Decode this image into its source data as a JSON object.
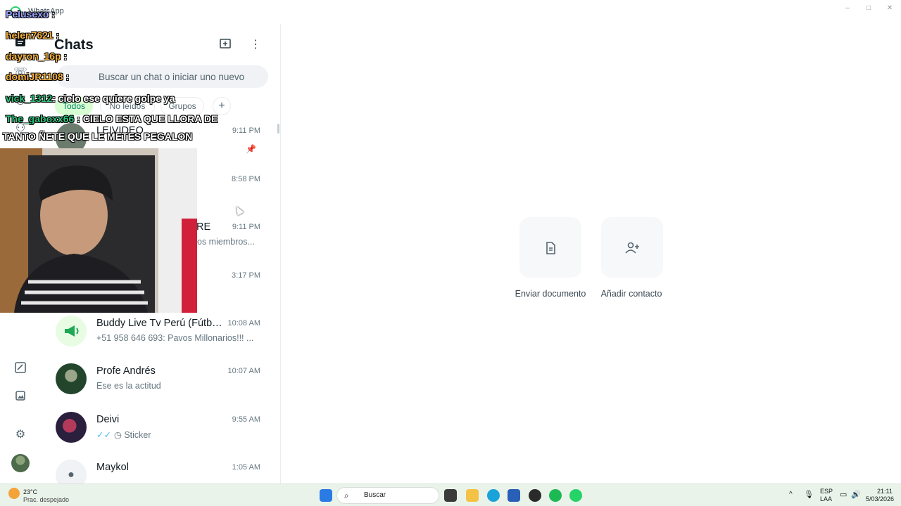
{
  "window": {
    "title": "WhatsApp",
    "controls": [
      "–",
      "□",
      "✕"
    ]
  },
  "rail": {
    "items": [
      "chats-icon",
      "calls-icon",
      "status-icon",
      "communities-icon",
      "starred-icon",
      "media-icon",
      "settings-icon"
    ]
  },
  "panel": {
    "title": "Chats",
    "search_placeholder": "Buscar un chat o iniciar uno nuevo",
    "filters": [
      {
        "label": "Todos",
        "active": true
      },
      {
        "label": "No leídos",
        "active": false
      },
      {
        "label": "Grupos",
        "active": false
      }
    ],
    "add_filter": "+"
  },
  "chats": [
    {
      "name": "LEIVIDEO",
      "time": "9:11 PM",
      "preview": "",
      "pinned": true
    },
    {
      "name": "",
      "time": "8:58 PM",
      "preview": ""
    },
    {
      "name": "RE",
      "time": "9:11 PM",
      "preview": "os miembros..."
    },
    {
      "name": "",
      "time": "3:17 PM",
      "preview": ""
    },
    {
      "name": "Buddy Live Tv Perú (Fútbol...",
      "time": "10:08 AM",
      "preview": "+51 958 646 693: Pavos Millonarios!!! ..."
    },
    {
      "name": "Profe Andrés",
      "time": "10:07 AM",
      "preview": "Ese es la actitud"
    },
    {
      "name": "Deivi",
      "time": "9:55 AM",
      "preview": "Sticker",
      "ticks": "✓✓"
    },
    {
      "name": "Maykol",
      "time": "1:05 AM",
      "preview": ""
    }
  ],
  "main": {
    "actions": [
      {
        "label": "Enviar documento",
        "icon": "document-icon"
      },
      {
        "label": "Añadir contacto",
        "icon": "add-contact-icon"
      }
    ]
  },
  "stream_overlay": {
    "lines": [
      {
        "user": "Pelusexo",
        "message": ":"
      },
      {
        "user": "helen7621",
        "message": ":"
      },
      {
        "user": "dayron_16p",
        "message": ":"
      },
      {
        "user": "domiJR1108",
        "message": ":"
      },
      {
        "user": "vick_1312",
        "message": ": cielo ese quiere golpe ya"
      },
      {
        "user": "The_gaboxx66",
        "message": ": CIELO ESTA QUE LLORA DE"
      },
      {
        "user": "",
        "message": "TANTO ÑETE QUE LE METES PEGALON"
      }
    ]
  },
  "taskbar": {
    "weather_temp": "23°C",
    "weather_desc": "Prac. despejado",
    "search_label": "Buscar",
    "lang_top": "ESP",
    "lang_bottom": "LAA",
    "time": "21:11",
    "date": "5/03/2026"
  }
}
